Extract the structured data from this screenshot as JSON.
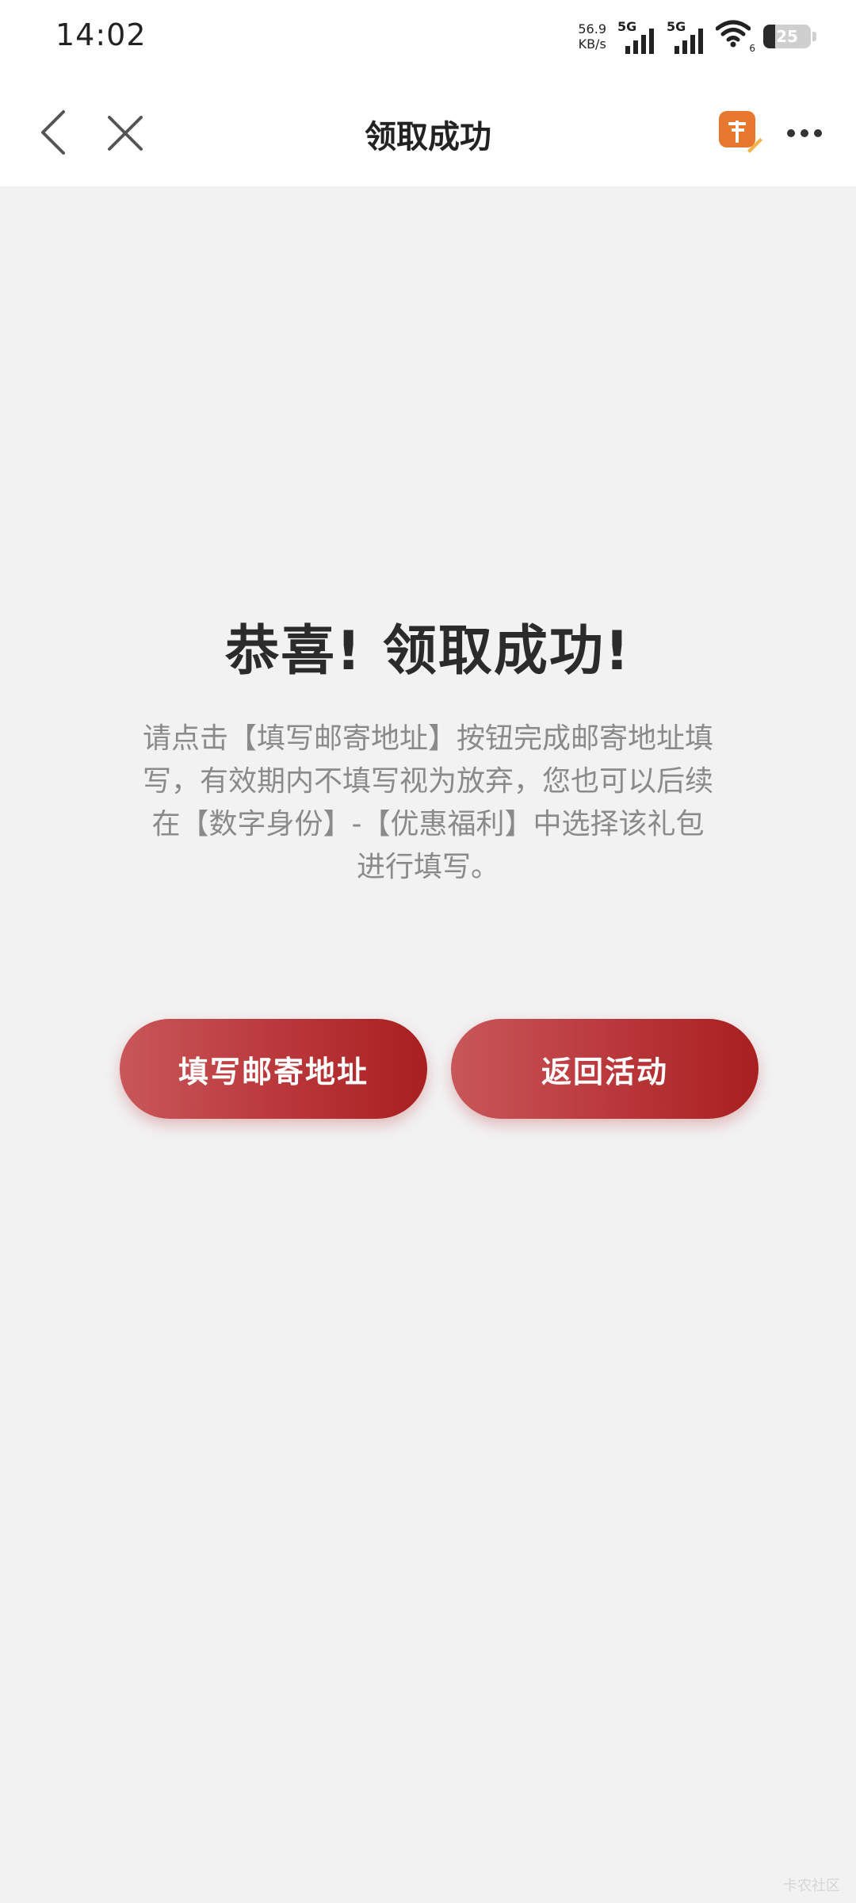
{
  "status": {
    "time": "14:02",
    "net_speed_value": "56.9",
    "net_speed_unit": "KB/s",
    "sim1_label": "5G",
    "sim2_label": "5G",
    "wifi_label": "6",
    "battery_level": "25",
    "battery_fraction": 0.25
  },
  "nav": {
    "title": "领取成功"
  },
  "main": {
    "headline": "恭喜! 领取成功!",
    "description": "请点击【填写邮寄地址】按钮完成邮寄地址填写，有效期内不填写视为放弃，您也可以后续在【数字身份】-【优惠福利】中选择该礼包进行填写。",
    "fill_address_label": "填写邮寄地址",
    "back_activity_label": "返回活动"
  },
  "watermark": "卡农社区",
  "colors": {
    "accent_start": "#c8575a",
    "accent_end": "#a8201f",
    "review_icon": "#e8772e"
  },
  "icons": {
    "back": "chevron-left-icon",
    "close": "close-icon",
    "review": "review-icon",
    "more": "more-dots-icon"
  }
}
